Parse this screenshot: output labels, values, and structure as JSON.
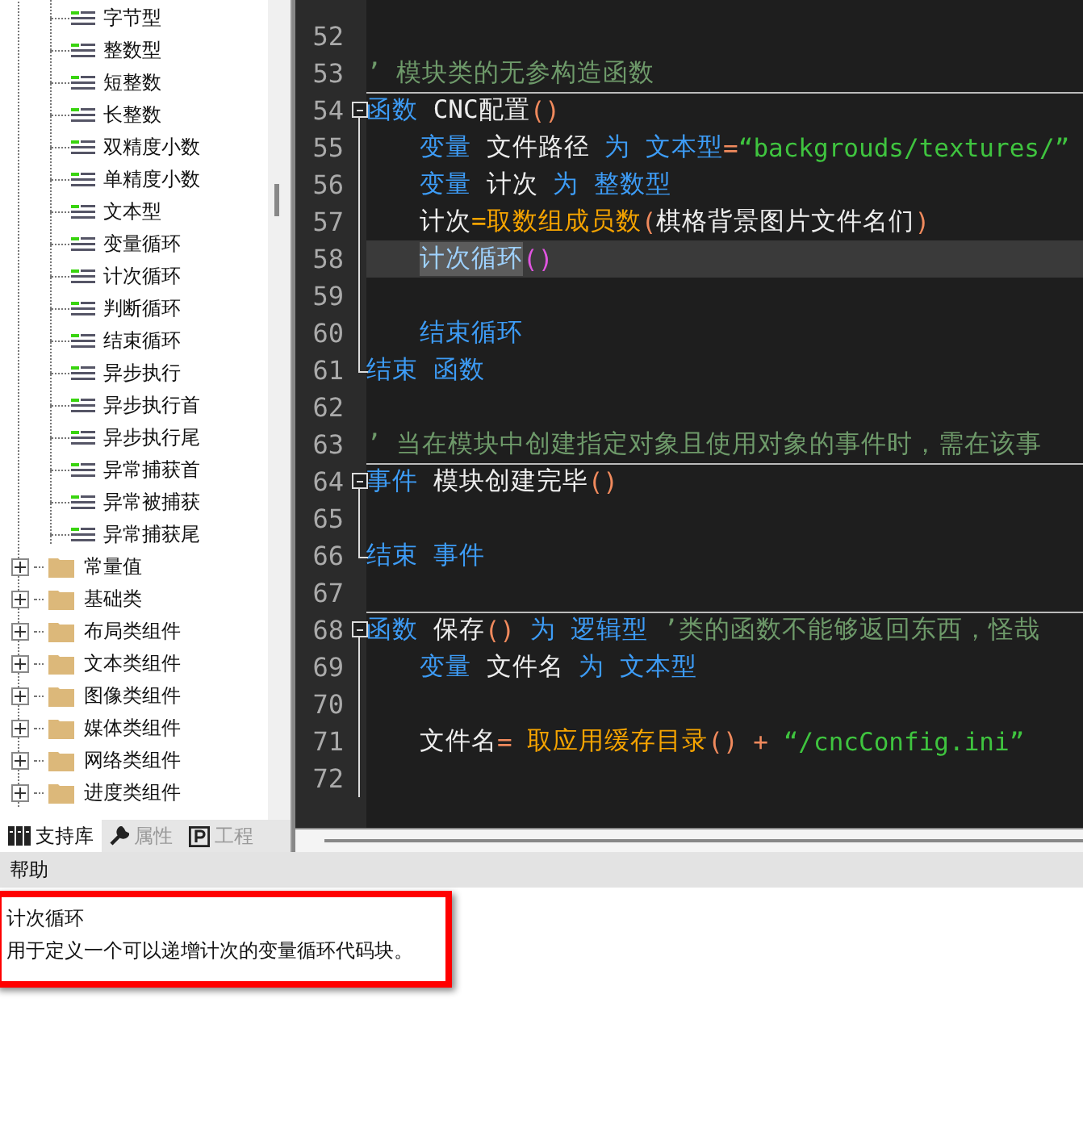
{
  "tree": {
    "leaves": [
      {
        "label": "字节型",
        "selected": false
      },
      {
        "label": "整数型",
        "selected": false
      },
      {
        "label": "短整数",
        "selected": false
      },
      {
        "label": "长整数",
        "selected": false
      },
      {
        "label": "双精度小数",
        "selected": false
      },
      {
        "label": "单精度小数",
        "selected": false
      },
      {
        "label": "文本型",
        "selected": false
      },
      {
        "label": "变量循环",
        "selected": false
      },
      {
        "label": "计次循环",
        "selected": false
      },
      {
        "label": "判断循环",
        "selected": false
      },
      {
        "label": "结束循环",
        "selected": false
      },
      {
        "label": "异步执行",
        "selected": false
      },
      {
        "label": "异步执行首",
        "selected": false
      },
      {
        "label": "异步执行尾",
        "selected": false
      },
      {
        "label": "异常捕获首",
        "selected": false
      },
      {
        "label": "异常被捕获",
        "selected": false
      },
      {
        "label": "异常捕获尾",
        "selected": false
      }
    ],
    "folders": [
      {
        "label": "常量值",
        "expanded": false
      },
      {
        "label": "基础类",
        "expanded": false
      },
      {
        "label": "布局类组件",
        "expanded": false
      },
      {
        "label": "文本类组件",
        "expanded": false
      },
      {
        "label": "图像类组件",
        "expanded": false
      },
      {
        "label": "媒体类组件",
        "expanded": false
      },
      {
        "label": "网络类组件",
        "expanded": false
      },
      {
        "label": "进度类组件",
        "expanded": false
      }
    ]
  },
  "panel_tabs": [
    {
      "label": "支持库",
      "kind": "library",
      "selected": true
    },
    {
      "label": "属性",
      "kind": "wrench",
      "selected": false
    },
    {
      "label": "工程",
      "kind": "project",
      "selected": false
    }
  ],
  "editor": {
    "lines": [
      {
        "num": "52",
        "current": false
      },
      {
        "num": "53",
        "current": false,
        "tokens": [
          {
            "kind": "comment",
            "text": "’ 模块类的无参构造函数"
          }
        ]
      },
      {
        "num": "54",
        "current": false,
        "tokens": [
          {
            "kind": "keyword",
            "text": "函数"
          },
          {
            "kind": "ident",
            "text": " CNC配置"
          },
          {
            "kind": "paren",
            "text": "()"
          }
        ],
        "children": [
          {
            "num": "55",
            "current": false,
            "tokens": [
              {
                "kind": "keyword",
                "text": "变量"
              },
              {
                "kind": "ident",
                "text": " 文件路径 "
              },
              {
                "kind": "keyword",
                "text": "为 文本型"
              },
              {
                "kind": "paren",
                "text": "="
              },
              {
                "kind": "string",
                "text": "“backgrouds/textures/”"
              }
            ]
          },
          {
            "num": "56",
            "current": false,
            "tokens": [
              {
                "kind": "keyword",
                "text": "变量"
              },
              {
                "kind": "ident",
                "text": " 计次 "
              },
              {
                "kind": "keyword",
                "text": "为 整数型"
              }
            ]
          },
          {
            "num": "57",
            "current": false,
            "tokens": [
              {
                "kind": "ident",
                "text": "计次"
              },
              {
                "kind": "func",
                "text": "=取数组成员数"
              },
              {
                "kind": "paren",
                "text": "("
              },
              {
                "kind": "ident",
                "text": "棋格背景图片文件名们"
              },
              {
                "kind": "paren",
                "text": ")"
              }
            ]
          },
          {
            "num": "58",
            "current": true,
            "tokens": [
              {
                "kind": "selected",
                "text": "计次循环"
              },
              {
                "kind": "bracket",
                "text": "()"
              }
            ]
          },
          {
            "num": "59",
            "current": false
          },
          {
            "num": "60",
            "current": false,
            "tokens": [
              {
                "kind": "keyword",
                "text": "结束循环"
              }
            ]
          }
        ],
        "closing": {
          "num": "61",
          "current": false,
          "tokens": [
            {
              "kind": "keyword",
              "text": "结束 函数"
            }
          ]
        }
      },
      {
        "num": "62",
        "current": false
      },
      {
        "num": "63",
        "current": false,
        "tokens": [
          {
            "kind": "comment",
            "text": "’ 当在模块中创建指定对象且使用对象的事件时，需在该事"
          }
        ]
      },
      {
        "num": "64",
        "current": false,
        "tokens": [
          {
            "kind": "keyword",
            "text": "事件"
          },
          {
            "kind": "ident",
            "text": " 模块创建完毕"
          },
          {
            "kind": "paren",
            "text": "()"
          }
        ],
        "children": [
          {
            "num": "65",
            "current": false
          }
        ],
        "closing": {
          "num": "66",
          "current": false,
          "tokens": [
            {
              "kind": "keyword",
              "text": "结束 事件"
            }
          ]
        }
      },
      {
        "num": "67",
        "current": false
      },
      {
        "num": "68",
        "current": false,
        "tokens": [
          {
            "kind": "keyword",
            "text": "函数"
          },
          {
            "kind": "ident",
            "text": " 保存"
          },
          {
            "kind": "paren",
            "text": "()"
          },
          {
            "kind": "keyword",
            "text": " 为 逻辑型"
          },
          {
            "kind": "comment",
            "text": " ’类的函数不能够返回东西，怪哉"
          }
        ],
        "children": [
          {
            "num": "69",
            "current": false,
            "tokens": [
              {
                "kind": "keyword",
                "text": "变量"
              },
              {
                "kind": "ident",
                "text": " 文件名 "
              },
              {
                "kind": "keyword",
                "text": "为 文本型"
              }
            ]
          },
          {
            "num": "70",
            "current": false
          },
          {
            "num": "71",
            "current": false,
            "tokens": [
              {
                "kind": "ident",
                "text": "文件名"
              },
              {
                "kind": "paren",
                "text": "= "
              },
              {
                "kind": "func",
                "text": "取应用缓存目录"
              },
              {
                "kind": "paren",
                "text": "() + "
              },
              {
                "kind": "string",
                "text": "“/cncConfig.ini”"
              }
            ]
          },
          {
            "num": "72",
            "current": false
          }
        ]
      }
    ]
  },
  "help": {
    "title": "帮助",
    "topic": "计次循环",
    "description": "用于定义一个可以递增计次的变量循环代码块。"
  }
}
